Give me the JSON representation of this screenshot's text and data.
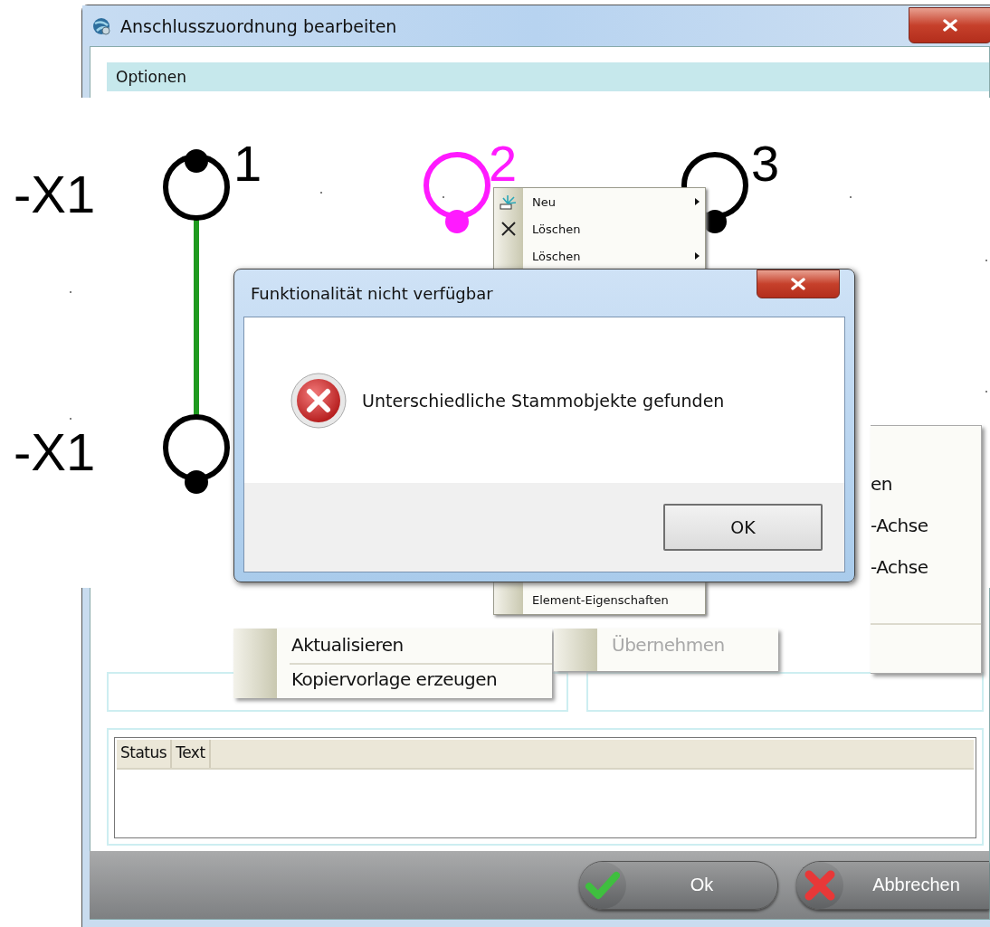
{
  "main_window": {
    "title": "Anschlusszuordnung bearbeiten",
    "options_header": "Optionen",
    "log_table": {
      "columns": [
        "Status",
        "Text"
      ]
    },
    "buttons": [
      {
        "label": "Ok",
        "kind": "ok"
      },
      {
        "label": "Abbrechen",
        "kind": "cancel"
      }
    ]
  },
  "schematic": {
    "terminals": [
      {
        "label": "-X1",
        "number": "1",
        "selected": false
      },
      {
        "label": "-X1",
        "selected": false
      },
      {
        "number": "2",
        "selected": true
      },
      {
        "number": "3",
        "selected": false
      }
    ]
  },
  "context_menu": {
    "items": [
      {
        "label": "Neu",
        "kind": "new",
        "submenu": true
      },
      {
        "label": "Löschen",
        "kind": "delete",
        "submenu": false
      },
      {
        "label": "Löschen",
        "submenu": true
      },
      {
        "label": "Element-Eigenschaften",
        "submenu": false
      }
    ]
  },
  "menu_fragments": [
    {
      "items": [
        {
          "label": "Aktualisieren",
          "disabled": false
        },
        {
          "label": "Kopiervorlage erzeugen",
          "disabled": false
        }
      ]
    },
    {
      "items": [
        {
          "label": "Übernehmen",
          "disabled": true
        }
      ]
    },
    {
      "items": [
        {
          "label": "en",
          "disabled": false
        },
        {
          "label": "-Achse",
          "disabled": false
        },
        {
          "label": "-Achse",
          "disabled": false
        }
      ]
    }
  ],
  "dialog": {
    "title": "Funktionalität nicht verfügbar",
    "message": "Unterschiedliche Stammobjekte gefunden",
    "button": "OK"
  }
}
